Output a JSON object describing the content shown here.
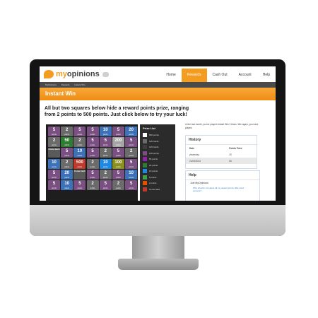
{
  "header": {
    "logo_prefix": "my",
    "logo_suffix": "opinions",
    "nav": [
      "Home",
      "Rewards",
      "Cash Out",
      "Account",
      "Help"
    ],
    "active_nav": "Rewards"
  },
  "breadcrumbs": [
    "MyOpinions",
    "Rewards",
    "Instant Win"
  ],
  "banner_title": "Instant Win",
  "headline": "All but two squares below hide a reward points prize, ranging from 2 points to 500 points. Just click below to try your luck!",
  "board": {
    "tiles": [
      {
        "v": "5",
        "c": "#7a4f82"
      },
      {
        "v": "2",
        "c": "#6b6b6b"
      },
      {
        "v": "5",
        "c": "#7a4f82"
      },
      {
        "v": "5",
        "c": "#7a4f82"
      },
      {
        "v": "10",
        "c": "#3d72b8"
      },
      {
        "v": "5",
        "c": "#7a4f82"
      },
      {
        "v": "20",
        "c": "#3d72b8"
      },
      {
        "v": "2",
        "c": "#6b6b6b"
      },
      {
        "v": "50",
        "c": "#2e7d32"
      },
      {
        "v": "2",
        "c": "#6b6b6b"
      },
      {
        "v": "5",
        "c": "#7a4f82"
      },
      {
        "v": "5",
        "c": "#7a4f82"
      },
      {
        "v": "200",
        "c": "#a5a5a5"
      },
      {
        "v": "5",
        "c": "#7a4f82"
      },
      {
        "v": "Come back",
        "c": "#5a5a5a"
      },
      {
        "v": "5",
        "c": "#7a4f82"
      },
      {
        "v": "10",
        "c": "#3d72b8"
      },
      {
        "v": "5",
        "c": "#7a4f82"
      },
      {
        "v": "2",
        "c": "#6b6b6b"
      },
      {
        "v": "5",
        "c": "#7a4f82"
      },
      {
        "v": "2",
        "c": "#6b6b6b"
      },
      {
        "v": "10",
        "c": "#3d72b8"
      },
      {
        "v": "2",
        "c": "#6b6b6b"
      },
      {
        "v": "500",
        "c": "#c0392b"
      },
      {
        "v": "2",
        "c": "#6b6b6b"
      },
      {
        "v": "10",
        "c": "#1e88e5"
      },
      {
        "v": "100",
        "c": "#8a8f1e"
      },
      {
        "v": "5",
        "c": "#7a4f82"
      },
      {
        "v": "5",
        "c": "#7a4f82"
      },
      {
        "v": "20",
        "c": "#3d72b8"
      },
      {
        "v": "Come back",
        "c": "#5a5a5a"
      },
      {
        "v": "5",
        "c": "#7a4f82"
      },
      {
        "v": "2",
        "c": "#6b6b6b"
      },
      {
        "v": "5",
        "c": "#7a4f82"
      },
      {
        "v": "10",
        "c": "#3d72b8"
      },
      {
        "v": "5",
        "c": "#7a4f82"
      },
      {
        "v": "10",
        "c": "#3d72b8"
      },
      {
        "v": "5",
        "c": "#7a4f82"
      },
      {
        "v": "2",
        "c": "#6b6b6b"
      },
      {
        "v": "5",
        "c": "#7a4f82"
      },
      {
        "v": "2",
        "c": "#6b6b6b"
      },
      {
        "v": "5",
        "c": "#7a4f82"
      }
    ],
    "tile_unit": "points"
  },
  "prize_list": {
    "title": "Prize List",
    "items": [
      {
        "label": "500 points",
        "color": "#ffffff"
      },
      {
        "label": "Gift Cards",
        "color": "#6b6b6b"
      },
      {
        "label": "Gift Cards",
        "color": "#3d3d3d"
      },
      {
        "label": "100 points",
        "color": "#7a4f82"
      },
      {
        "label": "50 points",
        "color": "#8e24aa"
      },
      {
        "label": "20 points",
        "color": "#2e7d32"
      },
      {
        "label": "10 points",
        "color": "#1e88e5"
      },
      {
        "label": "5 points",
        "color": "#43a047"
      },
      {
        "label": "2 points",
        "color": "#e65100"
      },
      {
        "label": "Come back",
        "color": "#c0392b"
      }
    ]
  },
  "sidebar": {
    "intro": "In the last month, you've played Instant Win 3 times. Win again, you have played.",
    "history": {
      "title": "History",
      "col_date": "Date",
      "col_points": "Points Prize",
      "rows": [
        {
          "date": "yesterday",
          "points": "20"
        },
        {
          "date": "21/03/2013",
          "points": "50"
        }
      ]
    },
    "help": {
      "title": "Help",
      "subtitle": "Join MyOpinions",
      "link": "Why should I complete all my reward points offers and surveys?"
    }
  }
}
